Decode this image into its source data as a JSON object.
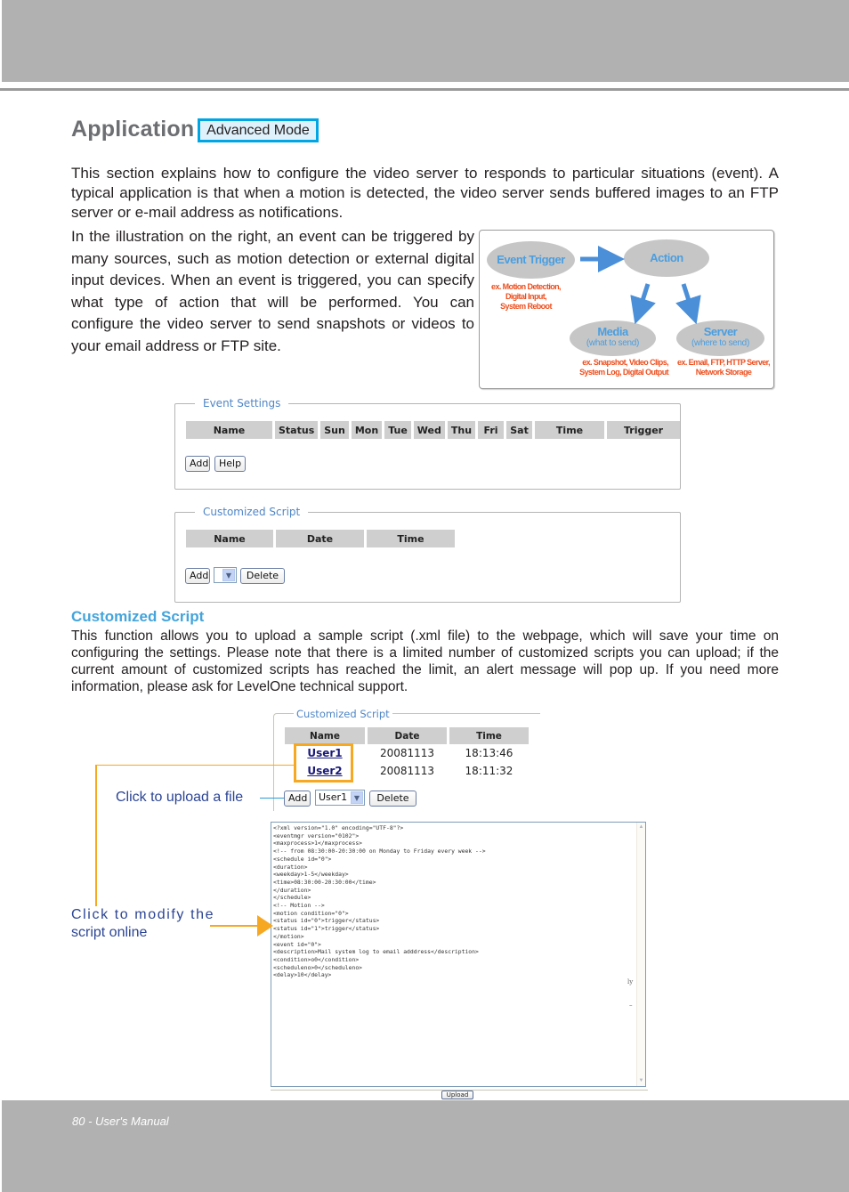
{
  "page": {
    "section_title": "Application",
    "mode_badge": "Advanced Mode",
    "intro_paragraph": "This section explains how to configure the video server to responds to particular situations (event). A typical application is that when a motion is detected, the video server sends buffered images to an FTP server or e-mail address as notifications.",
    "illustration_paragraph": "In the illustration on the right, an event can be triggered by many sources, such as motion detection or external digital input devices. When an event is triggered, you can specify what type of action that will be performed. You can configure the video server to send snapshots or videos to your email address or FTP site.",
    "footer": "80 - User's Manual"
  },
  "diagram": {
    "event_trigger": "Event Trigger",
    "event_trigger_examples": [
      "ex. Motion Detection,",
      "Digital Input,",
      "System Reboot"
    ],
    "action": "Action",
    "media": "Media",
    "media_sub": "(what to send)",
    "media_examples": [
      "ex. Snapshot, Video Clips,",
      "System Log, Digital Output"
    ],
    "server": "Server",
    "server_sub": "(where to send)",
    "server_examples": [
      "ex. Email, FTP, HTTP Server,",
      "Network Storage"
    ]
  },
  "event_settings": {
    "legend": "Event Settings",
    "columns": [
      "Name",
      "Status",
      "Sun",
      "Mon",
      "Tue",
      "Wed",
      "Thu",
      "Fri",
      "Sat",
      "Time",
      "Trigger"
    ],
    "add_label": "Add",
    "help_label": "Help"
  },
  "customized_script_empty": {
    "legend": "Customized Script",
    "columns": [
      "Name",
      "Date",
      "Time"
    ],
    "add_label": "Add",
    "select_value": "",
    "delete_label": "Delete"
  },
  "customized_script_section": {
    "heading": "Customized Script",
    "description": "This function allows you to upload a sample script (.xml file) to the webpage, which will save your time on configuring the settings. Please note that there is a limited number of customized scripts you can upload; if the current amount of customized scripts has reached the limit, an alert message will pop up. If you need more information, please ask for LevelOne technical support."
  },
  "customized_script_example": {
    "legend": "Customized Script",
    "columns": [
      "Name",
      "Date",
      "Time"
    ],
    "rows": [
      {
        "name": "User1",
        "date": "20081113",
        "time": "18:13:46"
      },
      {
        "name": "User2",
        "date": "20081113",
        "time": "18:11:32"
      }
    ],
    "add_label": "Add",
    "select_value": "User1",
    "delete_label": "Delete",
    "upload_label": "Upload",
    "script_lines": [
      "<?xml version=\"1.0\" encoding=\"UTF-8\"?>",
      "<eventmgr version=\"0102\">",
      "<maxprocess>1</maxprocess>",
      "<!-- from 08:30:00-20:30:00 on Monday to Friday every week -->",
      "<schedule id=\"0\">",
      "<duration>",
      "<weekday>1-5</weekday>",
      "<time>08:30:00-20:30:00</time>",
      "</duration>",
      "</schedule>",
      "<!-- Motion -->",
      "<motion condition=\"0\">",
      "<status id=\"0\">trigger</status>",
      "<status id=\"1\">trigger</status>",
      "</motion>",
      "<event id=\"0\">",
      "<description>Mail system log to email adddress</description>",
      "<condition>o0</condition>",
      "<scheduleno>0</scheduleno>",
      "<delay>10</delay>"
    ],
    "stray_marks": [
      "ly",
      "–"
    ]
  },
  "callouts": {
    "upload": "Click to upload a file",
    "modify_line1": "Click to modify the",
    "modify_line2": "script online"
  },
  "colors": {
    "header_gray": "#b1b1b1",
    "accent_blue": "#00a6e4",
    "heading_blue": "#44a4db",
    "legend_blue": "#4f86c6",
    "callout_orange": "#f7a823",
    "callout_text": "#2c4595",
    "example_orange": "#ee4d1c"
  }
}
